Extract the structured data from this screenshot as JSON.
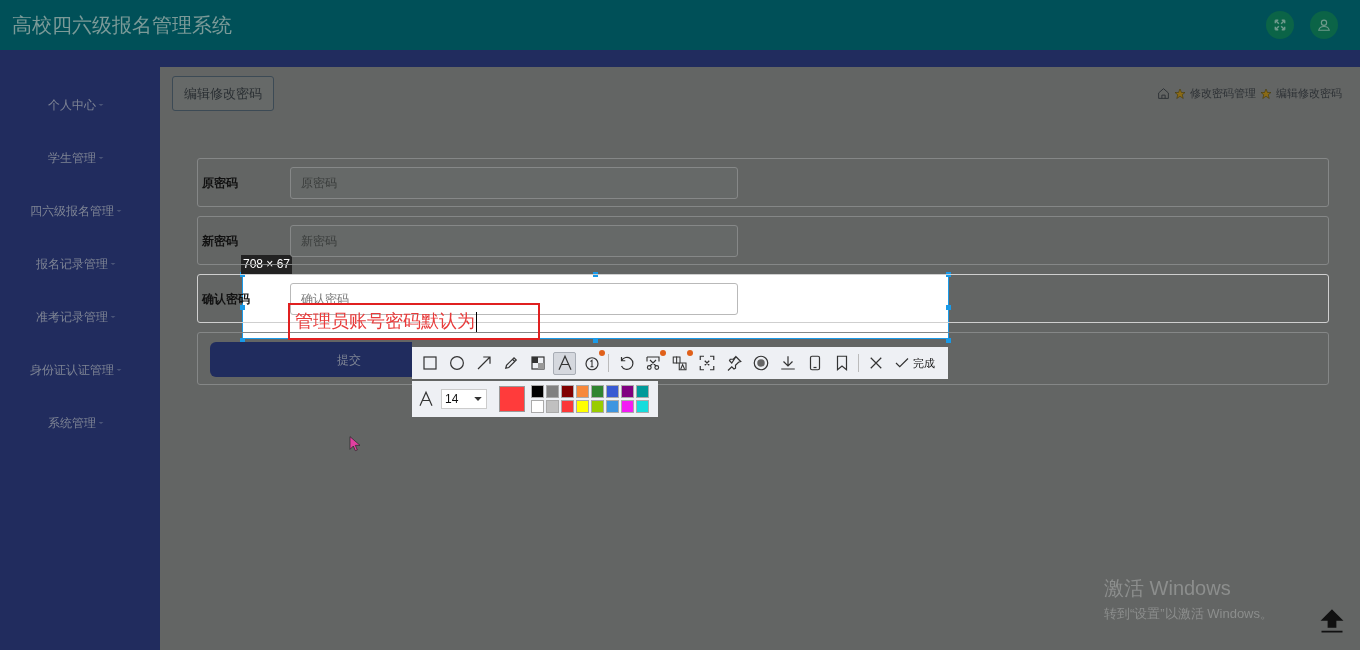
{
  "header": {
    "title": "高校四六级报名管理系统"
  },
  "sidebar": {
    "items": [
      {
        "label": "个人中心"
      },
      {
        "label": "学生管理"
      },
      {
        "label": "四六级报名管理"
      },
      {
        "label": "报名记录管理"
      },
      {
        "label": "准考记录管理"
      },
      {
        "label": "身份证认证管理"
      },
      {
        "label": "系统管理"
      }
    ]
  },
  "content": {
    "tab_button": "编辑修改密码",
    "breadcrumb": [
      "修改密码管理",
      "编辑修改密码"
    ],
    "fields": [
      {
        "label": "原密码",
        "placeholder": "原密码"
      },
      {
        "label": "新密码",
        "placeholder": "新密码"
      },
      {
        "label": "确认密码",
        "placeholder": "确认密码"
      }
    ],
    "submit": "提交"
  },
  "screenshot_tool": {
    "size_label": "708 × 67",
    "annotation_text": "管理员账号密码默认为",
    "tools": [
      {
        "kind": "rectangle",
        "selected": false,
        "dot": false
      },
      {
        "kind": "ellipse",
        "selected": false,
        "dot": false
      },
      {
        "kind": "arrow",
        "selected": false,
        "dot": false
      },
      {
        "kind": "pencil",
        "selected": false,
        "dot": false
      },
      {
        "kind": "mosaic",
        "selected": false,
        "dot": false
      },
      {
        "kind": "text",
        "selected": true,
        "dot": false
      },
      {
        "kind": "number",
        "selected": false,
        "dot": true
      },
      {
        "kind": "undo",
        "selected": false,
        "dot": false
      },
      {
        "kind": "scissors",
        "selected": false,
        "dot": true
      },
      {
        "kind": "translate",
        "selected": false,
        "dot": true
      },
      {
        "kind": "ocr",
        "selected": false,
        "dot": false
      },
      {
        "kind": "pin",
        "selected": false,
        "dot": false
      },
      {
        "kind": "record",
        "selected": false,
        "dot": false
      },
      {
        "kind": "download",
        "selected": false,
        "dot": false
      },
      {
        "kind": "phone",
        "selected": false,
        "dot": false
      },
      {
        "kind": "bookmark",
        "selected": false,
        "dot": false
      },
      {
        "kind": "close",
        "selected": false,
        "dot": false
      }
    ],
    "done": "完成",
    "font_size": "14",
    "current_swatch": {
      "color": "#ff3b3b"
    },
    "palette": [
      {
        "color": "#000000"
      },
      {
        "color": "#808080"
      },
      {
        "color": "#800000"
      },
      {
        "color": "#f7883a"
      },
      {
        "color": "#308430"
      },
      {
        "color": "#385ad3"
      },
      {
        "color": "#800080"
      },
      {
        "color": "#009999"
      },
      {
        "color": "#ffffff"
      },
      {
        "color": "#c0c0c0"
      },
      {
        "color": "#fb3838"
      },
      {
        "color": "#ffff00"
      },
      {
        "color": "#99cc00"
      },
      {
        "color": "#3d95e0"
      },
      {
        "color": "#f31bf3"
      },
      {
        "color": "#16dcdc"
      }
    ]
  },
  "watermark": {
    "title": "激活 Windows",
    "subtitle": "转到“设置”以激活 Windows。"
  }
}
